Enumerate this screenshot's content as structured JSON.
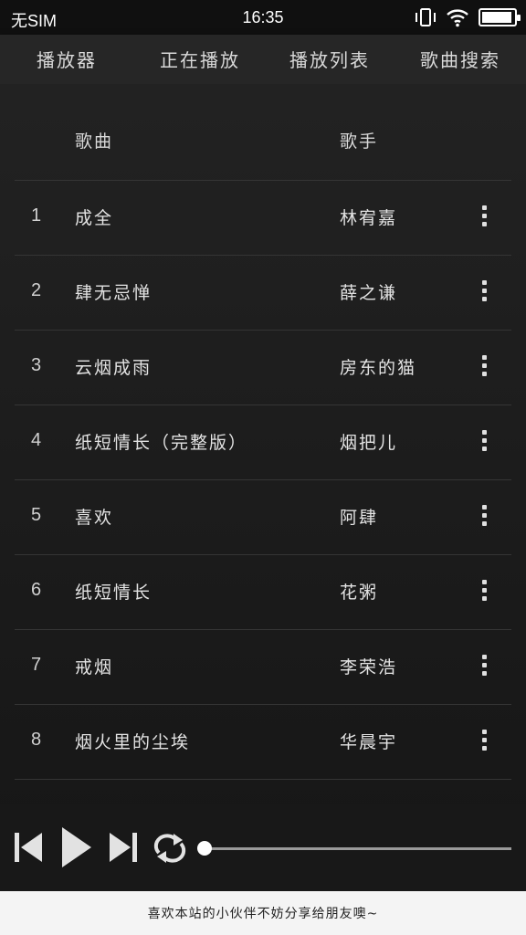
{
  "status_bar": {
    "carrier": "无SIM",
    "time": "16:35",
    "battery_level": 0.95
  },
  "nav": {
    "items": [
      "播放器",
      "正在播放",
      "播放列表",
      "歌曲搜索"
    ]
  },
  "list": {
    "headers": {
      "song": "歌曲",
      "artist": "歌手"
    },
    "rows": [
      {
        "num": "1",
        "title": "成全",
        "artist": "林宥嘉"
      },
      {
        "num": "2",
        "title": "肆无忌惮",
        "artist": "薛之谦"
      },
      {
        "num": "3",
        "title": "云烟成雨",
        "artist": "房东的猫"
      },
      {
        "num": "4",
        "title": "纸短情长（完整版）",
        "artist": "烟把儿"
      },
      {
        "num": "5",
        "title": "喜欢",
        "artist": "阿肆"
      },
      {
        "num": "6",
        "title": "纸短情长",
        "artist": "花粥"
      },
      {
        "num": "7",
        "title": "戒烟",
        "artist": "李荣浩"
      },
      {
        "num": "8",
        "title": "烟火里的尘埃",
        "artist": "华晨宇"
      }
    ]
  },
  "player": {
    "progress": 0,
    "icons": [
      "previous-icon",
      "play-icon",
      "next-icon",
      "repeat-icon"
    ]
  },
  "footer": {
    "text": "喜欢本站的小伙伴不妨分享给朋友噢~"
  }
}
